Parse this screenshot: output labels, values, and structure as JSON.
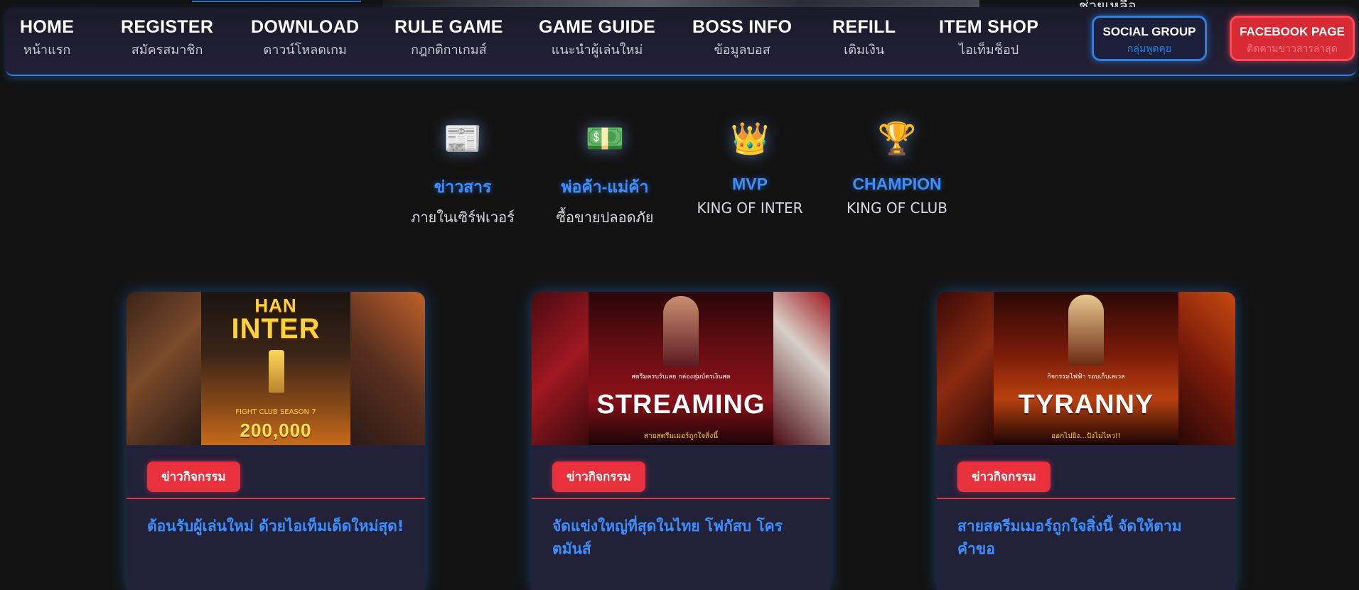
{
  "header": {
    "top_right_text": "ช่วยเหลือ"
  },
  "nav": {
    "items": [
      {
        "en": "HOME",
        "th": "หน้าแรก"
      },
      {
        "en": "REGISTER",
        "th": "สมัครสมาชิก"
      },
      {
        "en": "DOWNLOAD",
        "th": "ดาวน์โหลดเกม"
      },
      {
        "en": "RULE GAME",
        "th": "กฎกติกาเกมส์"
      },
      {
        "en": "GAME GUIDE",
        "th": "แนะนำผู้เล่นใหม่"
      },
      {
        "en": "BOSS INFO",
        "th": "ข้อมูลบอส"
      },
      {
        "en": "REFILL",
        "th": "เติมเงิน"
      },
      {
        "en": "ITEM SHOP",
        "th": "ไอเท็มช็อป"
      }
    ],
    "social": {
      "title": "SOCIAL GROUP",
      "sub": "กลุ่มพูดคุย"
    },
    "facebook": {
      "title": "FACEBOOK PAGE",
      "sub": "ติดตามข่าวสารล่าสุด"
    }
  },
  "features": [
    {
      "icon": "newspaper-icon",
      "glyph": "📰",
      "title": "ข่าวสาร",
      "sub": "ภายในเซิร์ฟเวอร์"
    },
    {
      "icon": "money-icon",
      "glyph": "💵",
      "title": "พ่อค้า-แม่ค้า",
      "sub": "ซื้อขายปลอดภัย"
    },
    {
      "icon": "crown-icon",
      "glyph": "👑",
      "title": "MVP",
      "sub": "KING OF INTER"
    },
    {
      "icon": "trophy-icon",
      "glyph": "🏆",
      "title": "CHAMPION",
      "sub": "KING OF CLUB"
    }
  ],
  "cards": [
    {
      "badge": "ข่าวกิจกรรม",
      "title": "ต้อนรับผู้เล่นใหม่ ด้วยไอเท็มเด็ดใหม่สุด!",
      "poster": {
        "line1": "HAN",
        "line2": "INTER",
        "small": "FIGHT CLUB SEASON 7",
        "big": "200,000"
      }
    },
    {
      "badge": "ข่าวกิจกรรม",
      "title": "จัดแข่งใหญ่ที่สุดในไทย โฟกัสบ โครตมันส์",
      "poster": {
        "line1": "สตรีมครบรับเลย กล่องสุ่มบัตรเงินสด",
        "line2": "STREAMING",
        "small": "สายสตรีมเมอร์ถูกใจสิ่งนี้",
        "big": ""
      }
    },
    {
      "badge": "ข่าวกิจกรรม",
      "title": "สายสตรีมเมอร์ถูกใจสิ่งนี้ จัดให้ตามคำขอ",
      "poster": {
        "line1": "กิจกรรมไฟฟ้า รอบเก็บเลเวล",
        "line2": "TYRANNY",
        "small": "ออกไปยิง...ปังไม่ไหว!!",
        "big": ""
      }
    }
  ],
  "colors": {
    "accent_blue": "#3d8eff",
    "accent_red": "#e8313c",
    "nav_bg": "#1b1a2a",
    "page_bg": "#121212"
  }
}
